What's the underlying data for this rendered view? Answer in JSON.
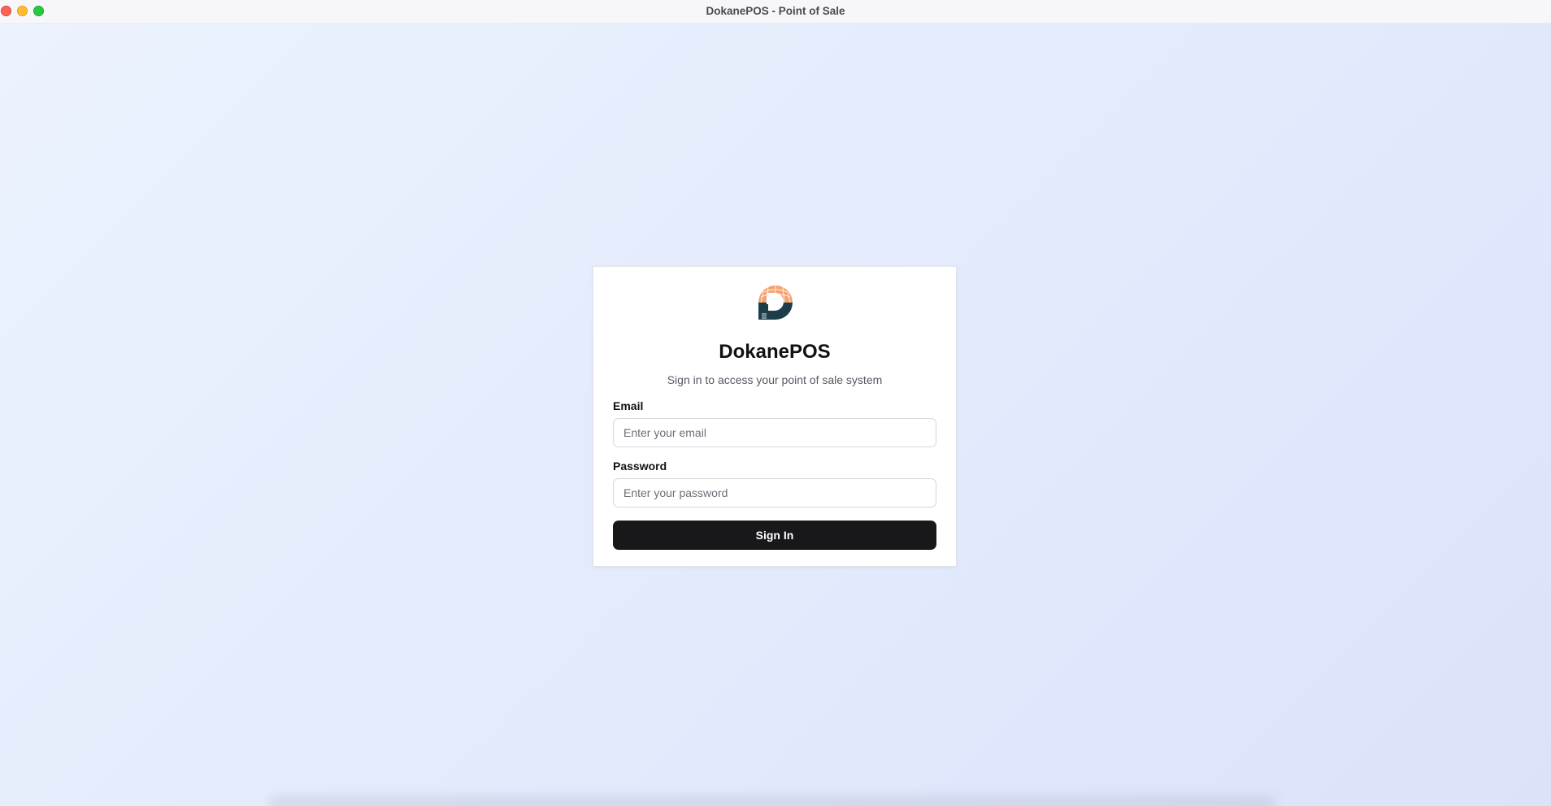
{
  "window": {
    "title": "DokanePOS - Point of Sale"
  },
  "login": {
    "app_name": "DokanePOS",
    "subtitle": "Sign in to access your point of sale system",
    "email": {
      "label": "Email",
      "value": "",
      "placeholder": "Enter your email"
    },
    "password": {
      "label": "Password",
      "value": "",
      "placeholder": "Enter your password"
    },
    "submit_label": "Sign In"
  },
  "icons": {
    "logo": "dokanepos-logo-icon",
    "close": "close-icon",
    "minimize": "minimize-icon",
    "zoom": "zoom-icon"
  },
  "colors": {
    "logo_orange": "#f4a270",
    "logo_teal": "#1d3d4a",
    "button_bg": "#18181a",
    "button_text": "#ffffff",
    "background_start": "#ecf3fe",
    "background_end": "#dbe3fb"
  }
}
